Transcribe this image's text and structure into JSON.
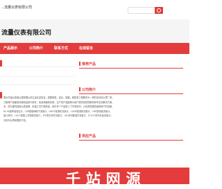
{
  "header": {
    "company_small": "...流量仪表有限公司",
    "company_title": "流量仪表有限公司"
  },
  "nav": {
    "items": [
      "产品展示",
      "公司简介",
      "联系方式",
      "在线留言"
    ]
  },
  "sections": {
    "recommend_title": "推荐产品",
    "intro_title": "公司简介",
    "products_title": "供应产品"
  },
  "intro": {
    "lines": [
      "寿州市温州流量仪表有限公司立足北京的日，是集研发、设计、制造、销售和工程服务为一体的自动化仪表厂家。",
      "力推荐产品都是设置精品进口原件，精品卓越的领域，生产的产品能够为用户提供优质的服务和专业的解决方案。",
      "本，成为国内智能仪表品牌，精湛工艺打造质量，其中多个产品进入了市场前列，以优质的服务赢得用户的信赖。",
      "DL-51超声波液位计、LZB型玻璃转子流量计、LWGY型涡轮流量计、LUGB型涡街流量计、LDE型电磁流量计。",
      "量计系列、LUCC型插入式电磁流量计、JFD型分体式流量计、ZJL系列管道式流量计、ZTLGY系列孔板流量计。",
      "光系列仪表和整机产品。"
    ]
  },
  "footer": {
    "brand_text": "千 站 网 源"
  },
  "colors": {
    "accent": "#e43c3c",
    "background": "#ffffff",
    "header_band": "#f5f5f5"
  },
  "icons": {
    "search": "search-icon"
  }
}
